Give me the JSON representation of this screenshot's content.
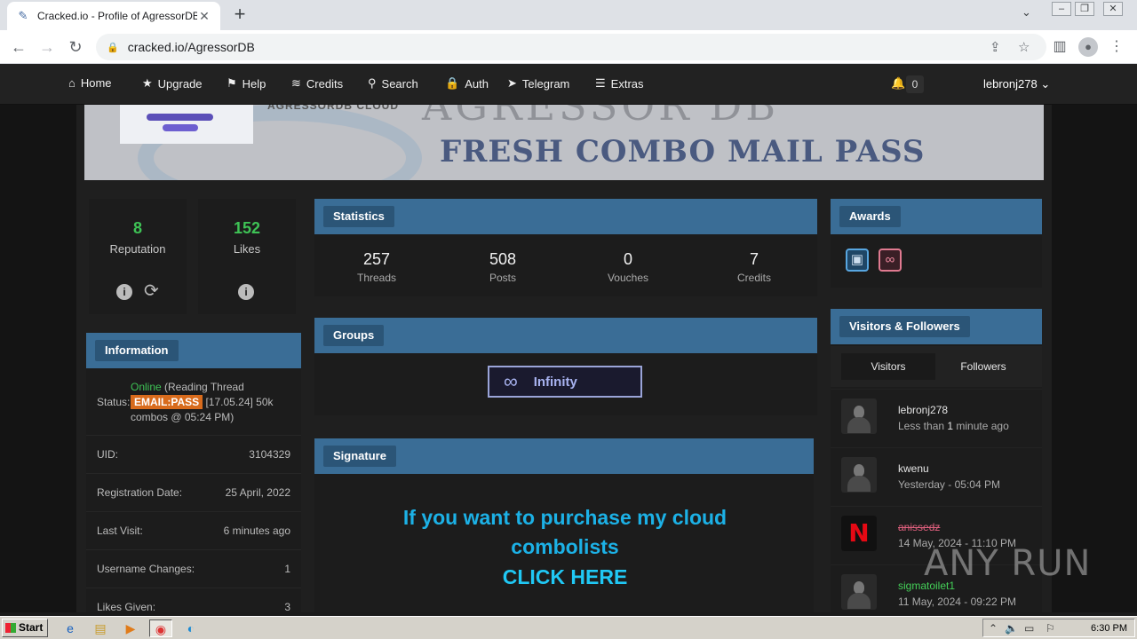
{
  "browser": {
    "tab_title": "Cracked.io - Profile of AgressorDB",
    "url": "cracked.io/AgressorDB"
  },
  "nav": {
    "items": [
      "Home",
      "Upgrade",
      "Help",
      "Credits",
      "Search",
      "Auth",
      "Telegram",
      "Extras"
    ],
    "notifications": "0",
    "username": "lebronj278"
  },
  "banner": {
    "caption": "AGRESSORDB CLOUD",
    "ghost_text": "AGRESSOR DB",
    "subtitle": "FRESH COMBO MAIL PASS"
  },
  "left": {
    "reputation_value": "8",
    "reputation_label": "Reputation",
    "likes_value": "152",
    "likes_label": "Likes",
    "information_title": "Information",
    "status_label": "Status:",
    "status_online": "Online",
    "status_reading": " (Reading Thread ",
    "status_tag": "EMAIL:PASS",
    "status_rest": " [17.05.24] 50k combos @ 05:24 PM)",
    "rows": [
      {
        "k": "UID:",
        "v": "3104329"
      },
      {
        "k": "Registration Date:",
        "v": "25 April, 2022"
      },
      {
        "k": "Last Visit:",
        "v": "6 minutes ago"
      },
      {
        "k": "Username Changes:",
        "v": "1"
      },
      {
        "k": "Likes Given:",
        "v": "3"
      }
    ]
  },
  "statistics": {
    "title": "Statistics",
    "items": [
      {
        "value": "257",
        "label": "Threads"
      },
      {
        "value": "508",
        "label": "Posts"
      },
      {
        "value": "0",
        "label": "Vouches"
      },
      {
        "value": "7",
        "label": "Credits"
      }
    ]
  },
  "groups": {
    "title": "Groups",
    "badge": "Infinity"
  },
  "signature": {
    "title": "Signature",
    "line1": "If you want to purchase my cloud",
    "line2": "combolists",
    "cta": "CLICK HERE"
  },
  "awards": {
    "title": "Awards"
  },
  "visitors": {
    "title": "Visitors & Followers",
    "tab_visitors": "Visitors",
    "tab_followers": "Followers",
    "list": [
      {
        "name": "lebronj278",
        "when_pre": "Less than ",
        "when_bold": "1",
        "when_post": " minute ago",
        "name_color": "#e4e4e4"
      },
      {
        "name": "kwenu",
        "when_pre": "Yesterday - 05:04 PM",
        "when_bold": "",
        "when_post": "",
        "name_color": "#e4e4e4"
      },
      {
        "name": "anissedz",
        "when_pre": "14 May, 2024 - 11:10 PM",
        "when_bold": "",
        "when_post": "",
        "name_color": "#e0607e"
      },
      {
        "name": "sigmatoilet1",
        "when_pre": "11 May, 2024 - 09:22 PM",
        "when_bold": "",
        "when_post": "",
        "name_color": "#44d058"
      }
    ]
  },
  "watermark": "ANY RUN",
  "taskbar": {
    "start": "Start",
    "clock": "6:30 PM"
  },
  "colors": {
    "accent_blue": "#3a6d96",
    "green": "#3ec255",
    "orange_tag": "#d86b1c",
    "signature_cyan": "#1cb1e6"
  }
}
